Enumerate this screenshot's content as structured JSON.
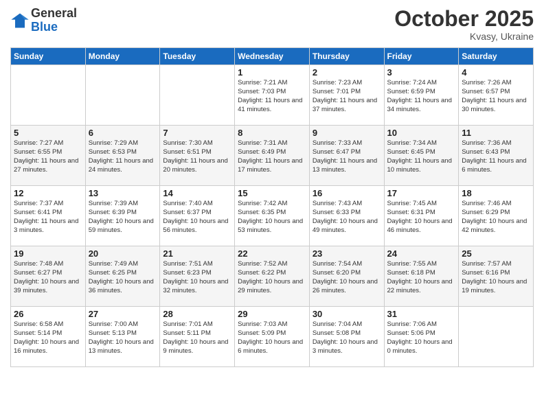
{
  "logo": {
    "general": "General",
    "blue": "Blue"
  },
  "title": "October 2025",
  "location": "Kvasy, Ukraine",
  "days_header": [
    "Sunday",
    "Monday",
    "Tuesday",
    "Wednesday",
    "Thursday",
    "Friday",
    "Saturday"
  ],
  "weeks": [
    [
      {
        "day": "",
        "info": ""
      },
      {
        "day": "",
        "info": ""
      },
      {
        "day": "",
        "info": ""
      },
      {
        "day": "1",
        "info": "Sunrise: 7:21 AM\nSunset: 7:03 PM\nDaylight: 11 hours\nand 41 minutes."
      },
      {
        "day": "2",
        "info": "Sunrise: 7:23 AM\nSunset: 7:01 PM\nDaylight: 11 hours\nand 37 minutes."
      },
      {
        "day": "3",
        "info": "Sunrise: 7:24 AM\nSunset: 6:59 PM\nDaylight: 11 hours\nand 34 minutes."
      },
      {
        "day": "4",
        "info": "Sunrise: 7:26 AM\nSunset: 6:57 PM\nDaylight: 11 hours\nand 30 minutes."
      }
    ],
    [
      {
        "day": "5",
        "info": "Sunrise: 7:27 AM\nSunset: 6:55 PM\nDaylight: 11 hours\nand 27 minutes."
      },
      {
        "day": "6",
        "info": "Sunrise: 7:29 AM\nSunset: 6:53 PM\nDaylight: 11 hours\nand 24 minutes."
      },
      {
        "day": "7",
        "info": "Sunrise: 7:30 AM\nSunset: 6:51 PM\nDaylight: 11 hours\nand 20 minutes."
      },
      {
        "day": "8",
        "info": "Sunrise: 7:31 AM\nSunset: 6:49 PM\nDaylight: 11 hours\nand 17 minutes."
      },
      {
        "day": "9",
        "info": "Sunrise: 7:33 AM\nSunset: 6:47 PM\nDaylight: 11 hours\nand 13 minutes."
      },
      {
        "day": "10",
        "info": "Sunrise: 7:34 AM\nSunset: 6:45 PM\nDaylight: 11 hours\nand 10 minutes."
      },
      {
        "day": "11",
        "info": "Sunrise: 7:36 AM\nSunset: 6:43 PM\nDaylight: 11 hours\nand 6 minutes."
      }
    ],
    [
      {
        "day": "12",
        "info": "Sunrise: 7:37 AM\nSunset: 6:41 PM\nDaylight: 11 hours\nand 3 minutes."
      },
      {
        "day": "13",
        "info": "Sunrise: 7:39 AM\nSunset: 6:39 PM\nDaylight: 10 hours\nand 59 minutes."
      },
      {
        "day": "14",
        "info": "Sunrise: 7:40 AM\nSunset: 6:37 PM\nDaylight: 10 hours\nand 56 minutes."
      },
      {
        "day": "15",
        "info": "Sunrise: 7:42 AM\nSunset: 6:35 PM\nDaylight: 10 hours\nand 53 minutes."
      },
      {
        "day": "16",
        "info": "Sunrise: 7:43 AM\nSunset: 6:33 PM\nDaylight: 10 hours\nand 49 minutes."
      },
      {
        "day": "17",
        "info": "Sunrise: 7:45 AM\nSunset: 6:31 PM\nDaylight: 10 hours\nand 46 minutes."
      },
      {
        "day": "18",
        "info": "Sunrise: 7:46 AM\nSunset: 6:29 PM\nDaylight: 10 hours\nand 42 minutes."
      }
    ],
    [
      {
        "day": "19",
        "info": "Sunrise: 7:48 AM\nSunset: 6:27 PM\nDaylight: 10 hours\nand 39 minutes."
      },
      {
        "day": "20",
        "info": "Sunrise: 7:49 AM\nSunset: 6:25 PM\nDaylight: 10 hours\nand 36 minutes."
      },
      {
        "day": "21",
        "info": "Sunrise: 7:51 AM\nSunset: 6:23 PM\nDaylight: 10 hours\nand 32 minutes."
      },
      {
        "day": "22",
        "info": "Sunrise: 7:52 AM\nSunset: 6:22 PM\nDaylight: 10 hours\nand 29 minutes."
      },
      {
        "day": "23",
        "info": "Sunrise: 7:54 AM\nSunset: 6:20 PM\nDaylight: 10 hours\nand 26 minutes."
      },
      {
        "day": "24",
        "info": "Sunrise: 7:55 AM\nSunset: 6:18 PM\nDaylight: 10 hours\nand 22 minutes."
      },
      {
        "day": "25",
        "info": "Sunrise: 7:57 AM\nSunset: 6:16 PM\nDaylight: 10 hours\nand 19 minutes."
      }
    ],
    [
      {
        "day": "26",
        "info": "Sunrise: 6:58 AM\nSunset: 5:14 PM\nDaylight: 10 hours\nand 16 minutes."
      },
      {
        "day": "27",
        "info": "Sunrise: 7:00 AM\nSunset: 5:13 PM\nDaylight: 10 hours\nand 13 minutes."
      },
      {
        "day": "28",
        "info": "Sunrise: 7:01 AM\nSunset: 5:11 PM\nDaylight: 10 hours\nand 9 minutes."
      },
      {
        "day": "29",
        "info": "Sunrise: 7:03 AM\nSunset: 5:09 PM\nDaylight: 10 hours\nand 6 minutes."
      },
      {
        "day": "30",
        "info": "Sunrise: 7:04 AM\nSunset: 5:08 PM\nDaylight: 10 hours\nand 3 minutes."
      },
      {
        "day": "31",
        "info": "Sunrise: 7:06 AM\nSunset: 5:06 PM\nDaylight: 10 hours\nand 0 minutes."
      },
      {
        "day": "",
        "info": ""
      }
    ]
  ]
}
